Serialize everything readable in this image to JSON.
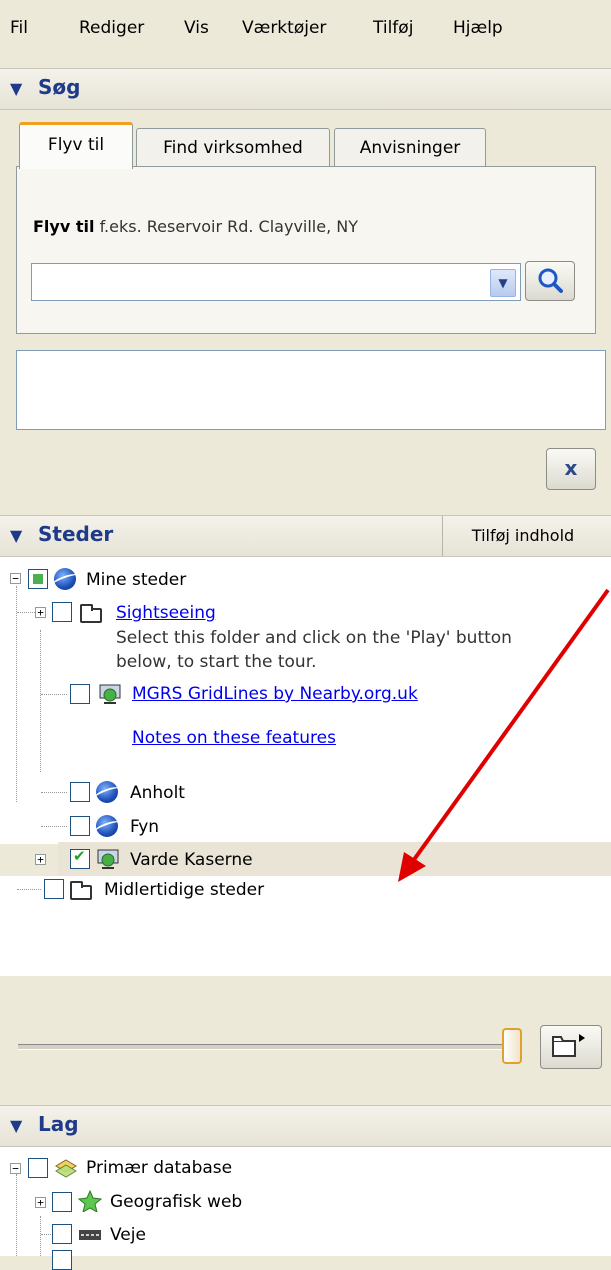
{
  "menu": [
    "Fil",
    "Rediger",
    "Vis",
    "Værktøjer",
    "Tilføj",
    "Hjælp"
  ],
  "search": {
    "title": "Søg",
    "tabs": [
      "Flyv til",
      "Find virksomhed",
      "Anvisninger"
    ],
    "hint_bold": "Flyv til",
    "hint_example": "f.eks. Reservoir Rd. Clayville, NY",
    "input_value": "",
    "close_label": "x"
  },
  "places": {
    "title": "Steder",
    "add_content": "Tilføj indhold",
    "items": {
      "mine_steder": "Mine steder",
      "sightseeing": "Sightseeing",
      "sightseeing_desc1": "Select this folder and click on the 'Play' button",
      "sightseeing_desc2": "below, to start the tour.",
      "mgrs": "MGRS GridLines by Nearby.org.uk",
      "notes": "Notes on these features",
      "anholt": "Anholt",
      "fyn": "Fyn",
      "varde": "Varde Kaserne",
      "midlertidige": "Midlertidige steder"
    }
  },
  "layers": {
    "title": "Lag",
    "items": {
      "primaer": "Primær database",
      "geografisk": "Geografisk web",
      "veje": "Veje"
    }
  },
  "colors": {
    "annotation_arrow": "#e00000",
    "header_text": "#1f3a8a",
    "selected_row": "#e9e4d6"
  }
}
